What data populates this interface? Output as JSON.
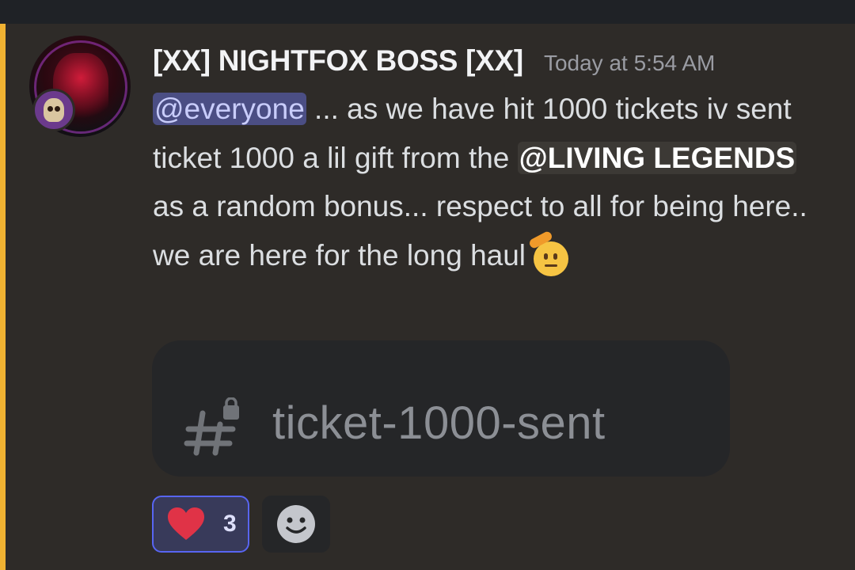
{
  "colors": {
    "background": "#2e2b28",
    "highlight_bar": "#f0b232",
    "username": "#f2f3f5",
    "timestamp": "#9a9ca3",
    "everyone_mention_bg": "#4b4e84",
    "reaction_border": "#5865f2"
  },
  "message": {
    "author": "[XX] NIGHTFOX BOSS [XX]",
    "timestamp": "Today at 5:54 AM",
    "avatar_icon": "hooded-reaper-avatar",
    "avatar_badge_icon": "skull-badge-icon",
    "mention_everyone": "@everyone",
    "text_part1": " ... as we have hit 1000 tickets iv sent ticket 1000 a lil gift from the ",
    "mention_role": "@LIVING LEGENDS",
    "text_part2": "  as a random bonus... respect to all for being here.. we are here for the long haul ",
    "emoji": "saluting-face-emoji"
  },
  "channel_link": {
    "icon": "locked-channel-hash-icon",
    "name": "ticket-1000-sent"
  },
  "reactions": [
    {
      "emoji": "heart-icon",
      "count": "3",
      "active": true
    }
  ],
  "add_reaction_icon": "add-reaction-smile-icon"
}
